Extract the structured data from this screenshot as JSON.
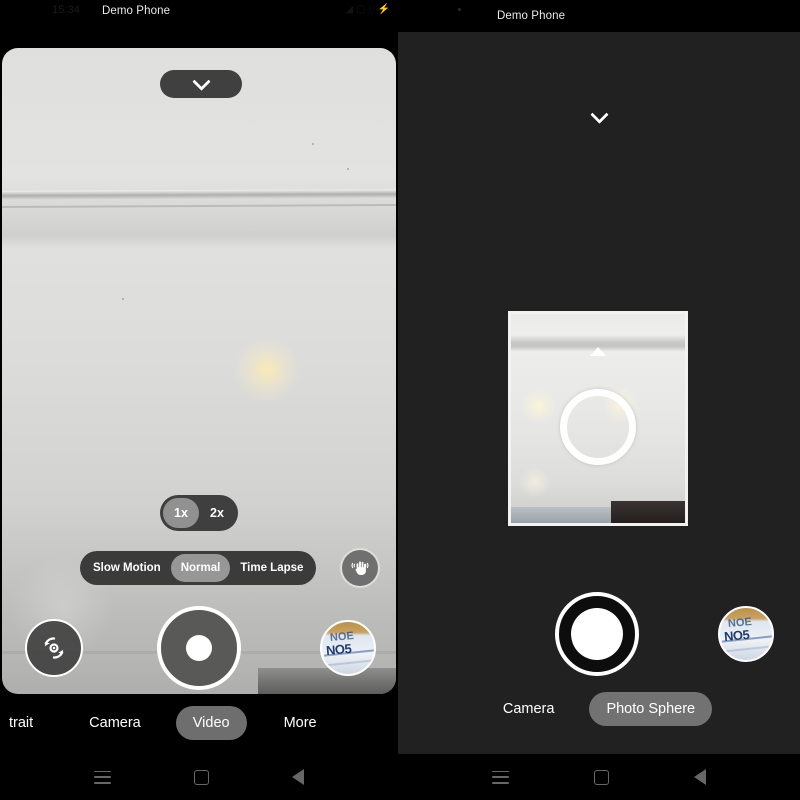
{
  "status": {
    "left": {
      "time": "15:34",
      "title": "Demo Phone"
    },
    "right": {
      "title": "Demo Phone"
    }
  },
  "left_panel": {
    "collapse_icon": "chevron-down-icon",
    "zoom_toggle": {
      "options": [
        {
          "label": "1x",
          "active": true
        },
        {
          "label": "2x",
          "active": false
        }
      ]
    },
    "video_modes": [
      {
        "label": "Slow Motion",
        "active": false
      },
      {
        "label": "Normal",
        "active": true
      },
      {
        "label": "Time Lapse",
        "active": false
      }
    ],
    "stabilization_icon": "hand-stabilization-icon",
    "switch_camera_icon": "camera-switch-icon",
    "shutter": {
      "name": "record-button",
      "kind": "video"
    },
    "gallery": {
      "name": "gallery-thumbnail",
      "caption": "NO5",
      "caption_sub": "NOE"
    },
    "mode_tabs": [
      {
        "label": "trait",
        "active": false
      },
      {
        "label": "Camera",
        "active": false
      },
      {
        "label": "Video",
        "active": true
      },
      {
        "label": "More",
        "active": false
      }
    ]
  },
  "right_panel": {
    "collapse_icon": "chevron-down-icon",
    "sphere_preview": {
      "name": "photo-sphere-preview",
      "target_icon": "ring-target-icon",
      "direction_icon": "triangle-up-icon"
    },
    "shutter": {
      "name": "shutter-button",
      "kind": "photo"
    },
    "gallery": {
      "name": "gallery-thumbnail",
      "caption": "NO5",
      "caption_sub": "NOE"
    },
    "mode_tabs": [
      {
        "label": "Camera",
        "active": false
      },
      {
        "label": "Photo Sphere",
        "active": true
      }
    ]
  },
  "navbar": {
    "recents": "recents-icon",
    "home": "home-icon",
    "back": "back-icon"
  },
  "colors": {
    "accent_active": "#9a9a9a",
    "control_bg": "#303030",
    "sphere_bg": "#212121",
    "white": "#ffffff"
  }
}
